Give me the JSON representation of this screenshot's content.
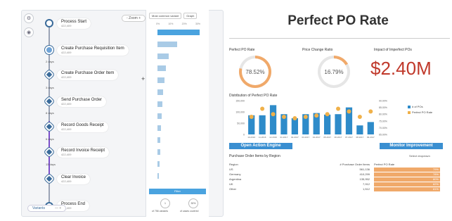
{
  "process": {
    "zoom_label": "- Zoom +",
    "steps": [
      {
        "label": "Process Start",
        "count": "422,409"
      },
      {
        "label": "Create Purchase Requisition Item",
        "count": "422,409"
      },
      {
        "label": "Create Purchase Order Item",
        "count": "422,409"
      },
      {
        "label": "Send Purchase Order",
        "count": "422,409"
      },
      {
        "label": "Record Goods Receipt",
        "count": "422,409"
      },
      {
        "label": "Record Invoice Receipt",
        "count": "422,409"
      },
      {
        "label": "Clear Invoice",
        "count": "422,409"
      },
      {
        "label": "Process End",
        "count": "422,409"
      }
    ],
    "durations": [
      "2 days",
      "3 days",
      "8 days",
      "6 days",
      "13 days"
    ],
    "variants_label": "Variants"
  },
  "variants": {
    "sort_label": "Most common variant",
    "graph_label": "Graph",
    "scale": [
      "0%",
      "10%",
      "20%",
      "30%"
    ],
    "bars": [
      {
        "value": 30
      },
      {
        "value": 14
      },
      {
        "value": 8
      },
      {
        "value": 6
      },
      {
        "value": 5
      },
      {
        "value": 4
      },
      {
        "value": 3.5
      },
      {
        "value": 3
      },
      {
        "value": 2.5
      },
      {
        "value": 2.2
      },
      {
        "value": 1.8
      },
      {
        "value": 1.5
      },
      {
        "value": 1.2
      }
    ],
    "filter_label": "Filter",
    "stat1_value": "1",
    "stat1_label": "of 756 variants",
    "stat2_value": "30%",
    "stat2_label": "of cases covered"
  },
  "dashboard": {
    "title": "Perfect PO Rate",
    "kpi1_label": "Perfect PO Rate",
    "kpi1_value": "78.52%",
    "kpi1_pct": 78.52,
    "kpi2_label": "Price Change Ratio",
    "kpi2_value": "16.79%",
    "kpi2_pct": 16.79,
    "kpi3_label": "Impact of Imperfect POs",
    "kpi3_value": "$2.40M",
    "dist_label": "Distribution of Perfect PO Rate",
    "open_action": "Open Action Engine",
    "monitor": "Monitor Improvement",
    "table_title": "Purchase Order Items by Region",
    "dropdown_label": "Select dropdown",
    "col_region": "Region",
    "col_items": "# Purchase Order Items",
    "col_pct": "Perfect PO Rate",
    "rows": [
      {
        "region": "US",
        "items": "561,136",
        "pct": "79%"
      },
      {
        "region": "Germany",
        "items": "410,299",
        "pct": "78%"
      },
      {
        "region": "Argentina",
        "items": "135,952",
        "pct": "80%"
      },
      {
        "region": "UK",
        "items": "7,912",
        "pct": "82%"
      },
      {
        "region": "Other",
        "items": "1,512",
        "pct": "81%"
      }
    ],
    "accent": "#3a8fd1",
    "orange": "#f0a96a",
    "red": "#c0392b"
  },
  "chart_data": {
    "type": "bar",
    "categories": [
      "10.2016",
      "11.2016",
      "12.2016",
      "01.2017",
      "02.2017",
      "03.2017",
      "04.2017",
      "05.2017",
      "06.2017",
      "07.2017",
      "08.2017",
      "09.2017"
    ],
    "series": [
      {
        "name": "# of POs",
        "values": [
          85000,
          85000,
          130000,
          90000,
          72000,
          90000,
          95000,
          88000,
          90000,
          120000,
          40000,
          55000
        ]
      },
      {
        "name": "Perfect PO Rate",
        "values": [
          78,
          84,
          80,
          78,
          77,
          78,
          79,
          80,
          84,
          82,
          78,
          82
        ]
      }
    ],
    "y_ticks": [
      "150,000",
      "100,000",
      "50,000",
      "0"
    ],
    "y2_ticks": [
      "90.00%",
      "85.00%",
      "80.00%",
      "75.00%",
      "70.00%",
      "65.00%"
    ],
    "ylim": [
      0,
      150000
    ],
    "y2lim": [
      65,
      90
    ]
  }
}
